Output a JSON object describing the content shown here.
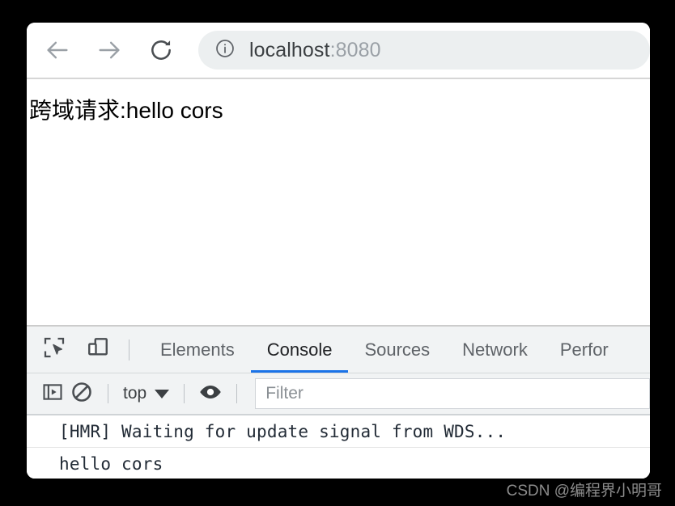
{
  "browser": {
    "toolbar": {
      "back_icon": "arrow-left-icon",
      "forward_icon": "arrow-right-icon",
      "reload_icon": "reload-icon",
      "site_info_icon": "info-circle-icon",
      "url_host": "localhost",
      "url_port": ":8080"
    },
    "page": {
      "body_text": "跨域请求:hello cors"
    }
  },
  "devtools": {
    "inspect_icon": "inspect-element-icon",
    "device_toggle_icon": "device-toolbar-icon",
    "tabs": [
      {
        "label": "Elements",
        "active": false
      },
      {
        "label": "Console",
        "active": true
      },
      {
        "label": "Sources",
        "active": false
      },
      {
        "label": "Network",
        "active": false
      },
      {
        "label": "Perfor",
        "active": false
      }
    ],
    "console_toolbar": {
      "sidebar_icon": "console-sidebar-icon",
      "clear_icon": "clear-console-icon",
      "context_label": "top",
      "context_caret_icon": "chevron-down-icon",
      "eye_icon": "live-expression-eye-icon",
      "filter_placeholder": "Filter",
      "filter_value": ""
    },
    "messages": [
      {
        "text": "[HMR] Waiting for update signal from WDS..."
      },
      {
        "text": "hello cors"
      }
    ]
  },
  "watermark": {
    "text": "CSDN @编程界小明哥"
  },
  "colors": {
    "accent_blue": "#1a73e8",
    "toolbar_bg": "#f1f3f4",
    "url_pill_bg": "#eceff0",
    "page_bg": "#ffffff",
    "backdrop": "#000000"
  }
}
